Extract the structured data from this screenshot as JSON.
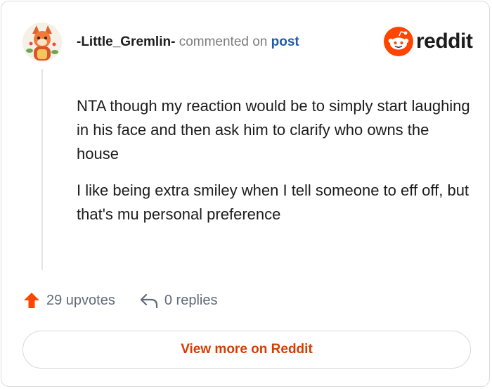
{
  "header": {
    "username": "-Little_Gremlin-",
    "action_text": "commented on",
    "post_link": "post"
  },
  "brand": {
    "name": "reddit",
    "color": "#ff4500"
  },
  "comment": {
    "paragraphs": [
      "NTA though my reaction would be to simply start laughing in his face and then ask him to clarify who owns the house",
      "I like being extra smiley when I tell someone to eff off, but that's mu personal preference"
    ]
  },
  "footer": {
    "upvotes": "29 upvotes",
    "replies": "0 replies"
  },
  "view_more_label": "View more on Reddit",
  "colors": {
    "upvote_icon": "#ff4500",
    "link": "#1e5ba8",
    "view_more_text": "#d63d00"
  }
}
